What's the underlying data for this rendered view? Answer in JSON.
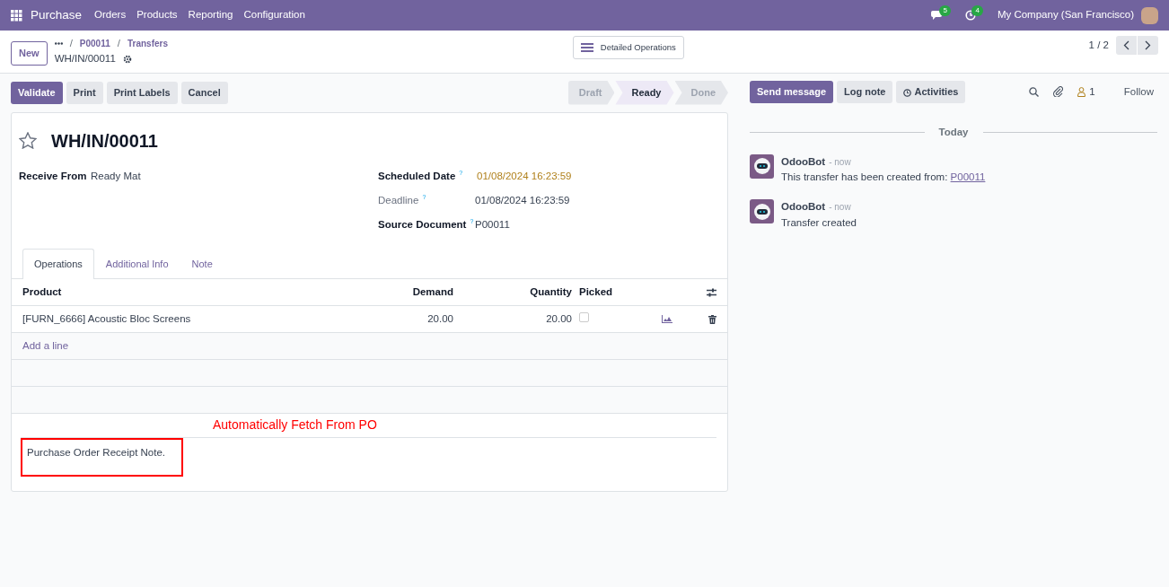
{
  "navbar": {
    "app": "Purchase",
    "menu": [
      "Orders",
      "Products",
      "Reporting",
      "Configuration"
    ],
    "messages_count": "5",
    "activities_count": "4",
    "company": "My Company (San Francisco)"
  },
  "control_panel": {
    "new_button": "New",
    "breadcrumbs": [
      {
        "separator": "/",
        "label": "P00011"
      },
      {
        "separator": "/",
        "label": "Transfers"
      }
    ],
    "record": "WH/IN/00011",
    "detailed_button": "Detailed Operations",
    "pager": "1 / 2"
  },
  "actions": [
    "Validate",
    "Print",
    "Print Labels",
    "Cancel"
  ],
  "stages": [
    {
      "label": "Draft",
      "selected": false
    },
    {
      "label": "Ready",
      "selected": true
    },
    {
      "label": "Done",
      "selected": false
    }
  ],
  "form": {
    "title": "WH/IN/00011",
    "starred": false,
    "left_fields": [
      {
        "label": "Receive From",
        "value": "Ready Mat",
        "muted": false
      }
    ],
    "right_fields": [
      {
        "label": "Scheduled Date",
        "value": "01/08/2024 16:23:59",
        "help": "?",
        "kind": "warning",
        "muted": false
      },
      {
        "label": "Deadline",
        "value": "01/08/2024 16:23:59",
        "help": "?",
        "kind": "plain",
        "muted": true
      },
      {
        "label": "Source Document",
        "value": "P00011",
        "help": "?",
        "kind": "plain",
        "muted": false
      }
    ],
    "tabs": [
      {
        "label": "Operations",
        "selected": true
      },
      {
        "label": "Additional Info",
        "selected": false
      },
      {
        "label": "Note",
        "selected": false
      }
    ],
    "table": {
      "columns": [
        "Product",
        "Demand",
        "Quantity",
        "Picked"
      ],
      "rows": [
        {
          "product": "[FURN_6666] Acoustic Bloc Screens",
          "demand": "20.00",
          "quantity": "20.00",
          "picked": false
        }
      ],
      "add_line": "Add a line"
    },
    "annotation": "Automatically Fetch From PO",
    "note": "Purchase Order Receipt Note."
  },
  "chatter": {
    "buttons": [
      {
        "label": "Send message",
        "selected": true
      },
      {
        "label": "Log note",
        "selected": false
      },
      {
        "label": "Activities",
        "selected": false
      }
    ],
    "followers": "1",
    "follow": "Follow",
    "date_label": "Today",
    "messages": [
      {
        "author": "OdooBot",
        "time": "- now",
        "body": "This transfer has been created from:",
        "link": "P00011"
      },
      {
        "author": "OdooBot",
        "time": "- now",
        "body": "Transfer created"
      }
    ]
  }
}
